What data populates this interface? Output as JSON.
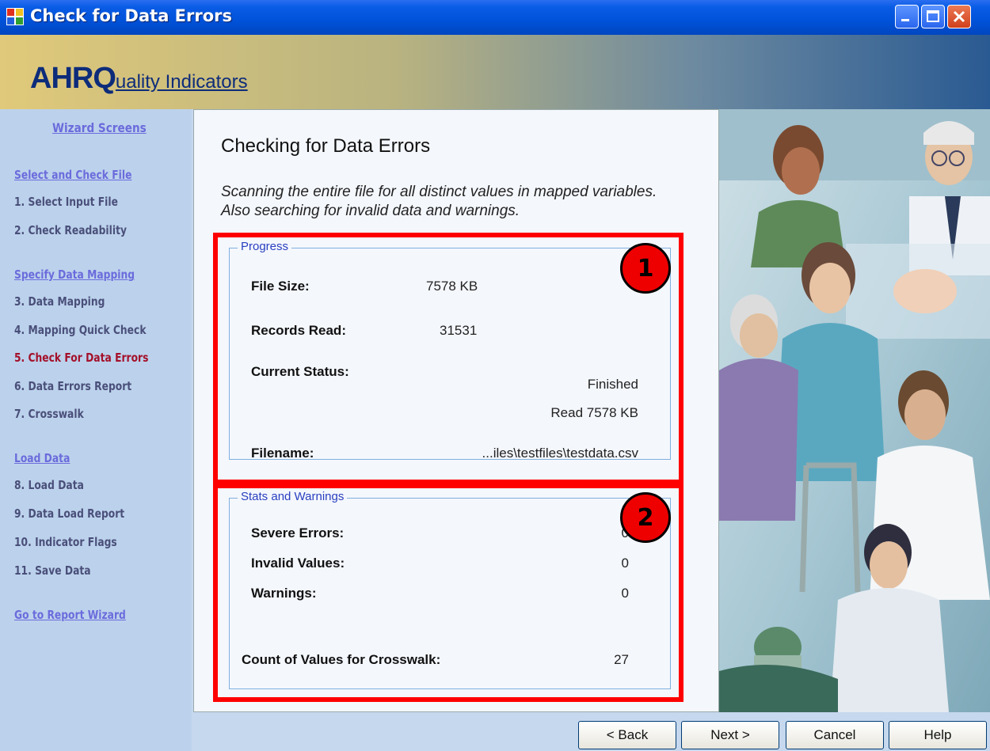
{
  "window": {
    "title": "Check for Data Errors"
  },
  "banner": {
    "logo_big": "AHRQ",
    "logo_small": "uality Indicators"
  },
  "sidebar": {
    "heading": "Wizard Screens",
    "items": [
      {
        "label": "Select and Check File",
        "kind": "section"
      },
      {
        "label": "1. Select Input File",
        "kind": "step"
      },
      {
        "label": "2. Check Readability",
        "kind": "step"
      },
      {
        "label": "Specify Data Mapping",
        "kind": "section"
      },
      {
        "label": "3. Data Mapping",
        "kind": "step"
      },
      {
        "label": "4. Mapping Quick Check",
        "kind": "step"
      },
      {
        "label": "5. Check For Data Errors",
        "kind": "current"
      },
      {
        "label": "6. Data Errors Report",
        "kind": "step"
      },
      {
        "label": "7. Crosswalk",
        "kind": "step"
      },
      {
        "label": "Load Data",
        "kind": "section"
      },
      {
        "label": "8. Load Data",
        "kind": "step"
      },
      {
        "label": "9. Data Load Report",
        "kind": "step"
      },
      {
        "label": "10. Indicator Flags",
        "kind": "step"
      },
      {
        "label": "11. Save Data",
        "kind": "step"
      },
      {
        "label": "Go to Report Wizard",
        "kind": "section"
      }
    ]
  },
  "main": {
    "title": "Checking for Data Errors",
    "description": "Scanning the entire file for all distinct values in mapped variables. Also searching for invalid data and warnings.",
    "progress": {
      "legend": "Progress",
      "file_size_label": "File Size:",
      "file_size_value": "7578 KB",
      "records_read_label": "Records Read:",
      "records_read_value": "31531",
      "current_status_label": "Current Status:",
      "status_line1": "Finished",
      "status_line2": "Read 7578 KB",
      "filename_label": "Filename:",
      "filename_value": "...iles\\testfiles\\testdata.csv"
    },
    "stats": {
      "legend": "Stats and Warnings",
      "severe_label": "Severe Errors:",
      "severe_value": "0",
      "invalid_label": "Invalid Values:",
      "invalid_value": "0",
      "warnings_label": "Warnings:",
      "warnings_value": "0",
      "crosswalk_label": "Count of Values for Crosswalk:",
      "crosswalk_value": "27"
    },
    "callouts": [
      "1",
      "2"
    ]
  },
  "buttons": {
    "back": "< Back",
    "next": "Next >",
    "cancel": "Cancel",
    "help": "Help"
  },
  "colors": {
    "highlight": "#ff0000",
    "current_step": "#a4102a",
    "section_link": "#6b6bdc",
    "titlebar": "#0052d9"
  }
}
